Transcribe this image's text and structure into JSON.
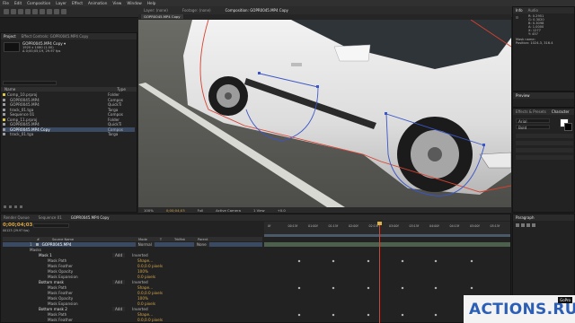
{
  "menu": [
    "File",
    "Edit",
    "Composition",
    "Layer",
    "Effect",
    "Animation",
    "View",
    "Window",
    "Help"
  ],
  "project": {
    "tabs": [
      "Project",
      "Effect Controls: GOPR0045.MP4 Copy"
    ],
    "selected_name": "GOPR0045.MP4 Copy ▾",
    "selected_info": [
      "1920 x 1080 (1.00)",
      "Δ 0;00;05;19, 29.97 fps"
    ],
    "columns": [
      "Name",
      "Type"
    ],
    "items": [
      {
        "name": "Comp_10.prproj",
        "type": "Folder",
        "color": "#d8c84a",
        "folder": true
      },
      {
        "name": "GOPR0045.MP4",
        "type": "Compos",
        "color": "#9a9aa0"
      },
      {
        "name": "GOPR0045.MP4",
        "type": "QuickTi",
        "color": "#9a9aa0"
      },
      {
        "name": "track_01.tga",
        "type": "Targa",
        "color": "#9a9aa0"
      },
      {
        "name": "Sequence 01",
        "type": "Compos",
        "color": "#9a9aa0"
      },
      {
        "name": "Comp_11.prproj",
        "type": "Folder",
        "color": "#d8c84a",
        "folder": true
      },
      {
        "name": "GOPR0045.MP4",
        "type": "QuickTi",
        "color": "#9a9aa0"
      },
      {
        "name": "GOPR0045.MP4 Copy",
        "type": "Compos",
        "color": "#9a9aa0",
        "selected": true
      },
      {
        "name": "track_01.tga",
        "type": "Targa",
        "color": "#9a9aa0"
      }
    ]
  },
  "viewer": {
    "tabs": [
      "Layer: (none)",
      "Footage: (none)",
      "Composition: GOPR0045.MP4 Copy"
    ],
    "sub_tab": "GOPR0045.MP4 Copy",
    "footer": {
      "zoom": "100%",
      "time": "0;00;04;03",
      "res": "Full",
      "camera": "Active Camera",
      "views": "1 View",
      "offset": "+0.0"
    }
  },
  "info": {
    "tabs": [
      "Info",
      "Audio"
    ],
    "values": [
      "R: 0.2951",
      "G: 0.3020",
      "B: 0.3098",
      "A: 1.0000",
      "X: 1277",
      "Y: 457"
    ],
    "mask_title": "Mask name:",
    "mask_pos": "Position: 1024.3, 316.4"
  },
  "preview": {
    "tab": "Preview"
  },
  "effects": {
    "tabs": [
      "Effects & Presets",
      "Character"
    ],
    "font": "Arial",
    "style": "Bold"
  },
  "paragraph": {
    "tab": "Paragraph"
  },
  "timeline": {
    "tabs": [
      "Render Queue",
      "Sequence 01",
      "GOPR0045.MP4 Copy"
    ],
    "timecode": "0;00;04;03",
    "frame": "00123 (29.97 fps)",
    "header": [
      "#",
      "Source Name",
      "Mode",
      "T",
      "TrkMat",
      "Parent"
    ],
    "ruler": [
      "0f",
      "00:15f",
      "01:00f",
      "01:15f",
      "02:00f",
      "02:15f",
      "03:00f",
      "03:15f",
      "04:00f",
      "04:15f",
      "05:00f",
      "05:15f"
    ],
    "layer": {
      "index": "1",
      "name": "GOPR0045.MP4",
      "mode": "Normal",
      "parent": "None"
    },
    "rows": [
      {
        "label": "Masks",
        "indent": 1,
        "kind": "group"
      },
      {
        "label": "Mask 1",
        "indent": 2,
        "kind": "mask",
        "mode": "Add",
        "inverted": "Inverted"
      },
      {
        "label": "Mask Path",
        "indent": 3,
        "kind": "prop",
        "value": "Shape..."
      },
      {
        "label": "Mask Feather",
        "indent": 3,
        "kind": "prop",
        "value": "0.0,0.0 pixels"
      },
      {
        "label": "Mask Opacity",
        "indent": 3,
        "kind": "prop",
        "value": "100%"
      },
      {
        "label": "Mask Expansion",
        "indent": 3,
        "kind": "prop",
        "value": "0.0 pixels"
      },
      {
        "label": "Bottom mask",
        "indent": 2,
        "kind": "mask",
        "mode": "Add",
        "inverted": "Inverted"
      },
      {
        "label": "Mask Path",
        "indent": 3,
        "kind": "prop",
        "value": "Shape..."
      },
      {
        "label": "Mask Feather",
        "indent": 3,
        "kind": "prop",
        "value": "0.0,0.0 pixels"
      },
      {
        "label": "Mask Opacity",
        "indent": 3,
        "kind": "prop",
        "value": "100%"
      },
      {
        "label": "Mask Expansion",
        "indent": 3,
        "kind": "prop",
        "value": "0.0 pixels"
      },
      {
        "label": "Bottom mask 2",
        "indent": 2,
        "kind": "mask",
        "mode": "Add",
        "inverted": "Inverted"
      },
      {
        "label": "Mask Path",
        "indent": 3,
        "kind": "prop",
        "value": "Shape..."
      },
      {
        "label": "Mask Feather",
        "indent": 3,
        "kind": "prop",
        "value": "0.0,0.0 pixels"
      }
    ]
  },
  "watermark": {
    "brand": "ACTIONS.RU",
    "badge": "GoPro"
  }
}
